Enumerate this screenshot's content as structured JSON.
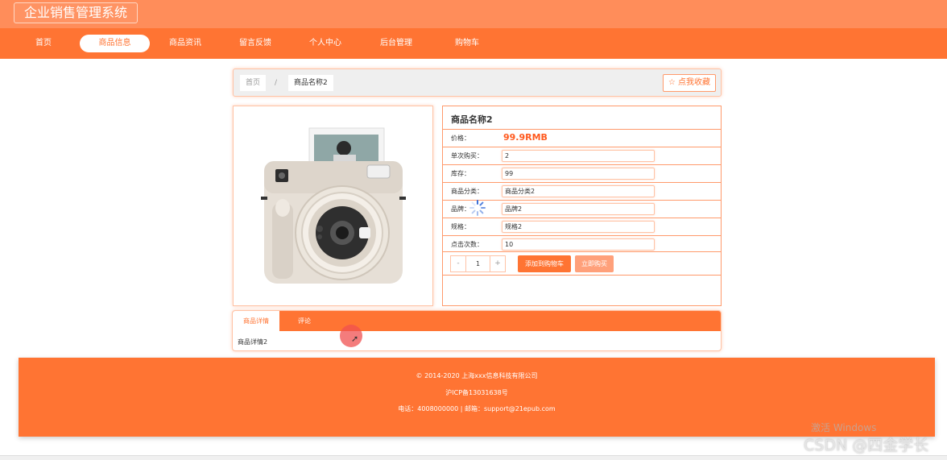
{
  "app": {
    "title": "企业销售管理系统"
  },
  "nav": {
    "items": [
      {
        "label": "首页"
      },
      {
        "label": "商品信息"
      },
      {
        "label": "商品资讯"
      },
      {
        "label": "留言反馈"
      },
      {
        "label": "个人中心"
      },
      {
        "label": "后台管理"
      },
      {
        "label": "购物车"
      }
    ],
    "active": "商品信息"
  },
  "breadcrumb": {
    "home": "首页",
    "separator": "/",
    "current": "商品名称2",
    "favorite": "☆ 点我收藏"
  },
  "product": {
    "name": "商品名称2",
    "price_label": "价格：",
    "price": "99.9RMB",
    "fields": [
      {
        "label": "单次购买：",
        "value": "2"
      },
      {
        "label": "库存：",
        "value": "99"
      },
      {
        "label": "商品分类：",
        "value": "商品分类2"
      },
      {
        "label": "品牌：",
        "value": "品牌2"
      },
      {
        "label": "规格：",
        "value": "规格2"
      },
      {
        "label": "点击次数：",
        "value": "10"
      }
    ],
    "quantity": "1",
    "minus": "-",
    "plus": "+",
    "add_to_cart": "添加到购物车",
    "buy_now": "立即购买"
  },
  "tabs": {
    "items": [
      {
        "label": "商品详情"
      },
      {
        "label": "评论"
      }
    ],
    "content": "商品详情2"
  },
  "footer": {
    "copyright": "© 2014-2020 上海xxx信息科技有限公司",
    "icp": "沪ICP备13031638号",
    "contact": "电话：4008000000 | 邮箱：support@21epub.com"
  },
  "overlay": {
    "activate_windows": "激活 Windows",
    "csdn": "CSDN @四金学长"
  },
  "colors": {
    "accent": "#ff7433",
    "topbar": "#ff8d5a",
    "price": "#ff5a1f"
  },
  "icons": [
    "star-icon",
    "loading-spinner-icon",
    "mouse-cursor-icon"
  ]
}
